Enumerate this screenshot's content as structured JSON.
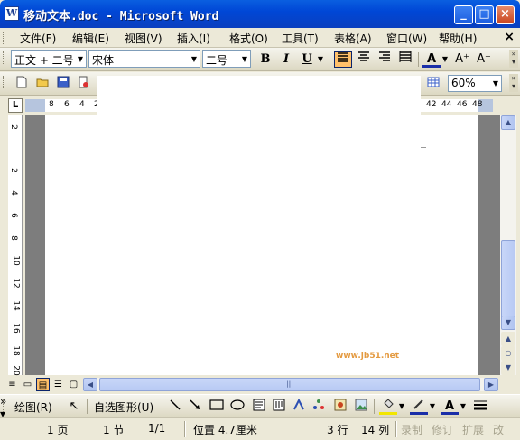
{
  "window": {
    "title": "移动文本.doc - Microsoft Word",
    "app_icon": "W",
    "minimize": "_",
    "maximize": "□",
    "close": "×"
  },
  "menubar": {
    "items": [
      "文件(F)",
      "编辑(E)",
      "视图(V)",
      "插入(I)",
      "格式(O)",
      "工具(T)",
      "表格(A)",
      "窗口(W)",
      "帮助(H)"
    ],
    "close": "×"
  },
  "format_toolbar": {
    "style": "正文 + 二号",
    "font": "宋体",
    "size": "二号",
    "bold": "B",
    "italic": "I",
    "underline": "U",
    "font_color": "A",
    "grow": "A⁺",
    "shrink": "A⁻"
  },
  "standard_toolbar": {
    "zoom": "60%",
    "icons": [
      "new-icon",
      "open-icon",
      "save-icon",
      "permission-icon",
      "email-icon",
      "print-icon",
      "preview-icon",
      "spelling-icon",
      "research-icon",
      "cut-icon",
      "copy-icon",
      "paste-icon",
      "format-painter-icon",
      "undo-icon",
      "redo-icon",
      "hyperlink-icon",
      "table-icon"
    ]
  },
  "ruler": {
    "left_numbers": [
      "8",
      "6",
      "4",
      "2"
    ],
    "right_numbers": [
      "42",
      "44",
      "46",
      "48"
    ],
    "tab_stop": "L"
  },
  "vertical_ruler": {
    "numbers": [
      "2",
      "2",
      "4",
      "6",
      "8",
      "10",
      "12",
      "14",
      "16",
      "18",
      "20"
    ]
  },
  "drawing_toolbar": {
    "draw": "绘图(R)",
    "autoshapes": "自选图形(U)"
  },
  "statusbar": {
    "page": "1 页",
    "section": "1 节",
    "page_of": "1/1",
    "position": "位置 4.7厘米",
    "line": "3 行",
    "column": "14 列",
    "rec": "录制",
    "trk": "修订",
    "ext": "扩展",
    "ovr": "改"
  },
  "watermark": "www.jb51.net"
}
